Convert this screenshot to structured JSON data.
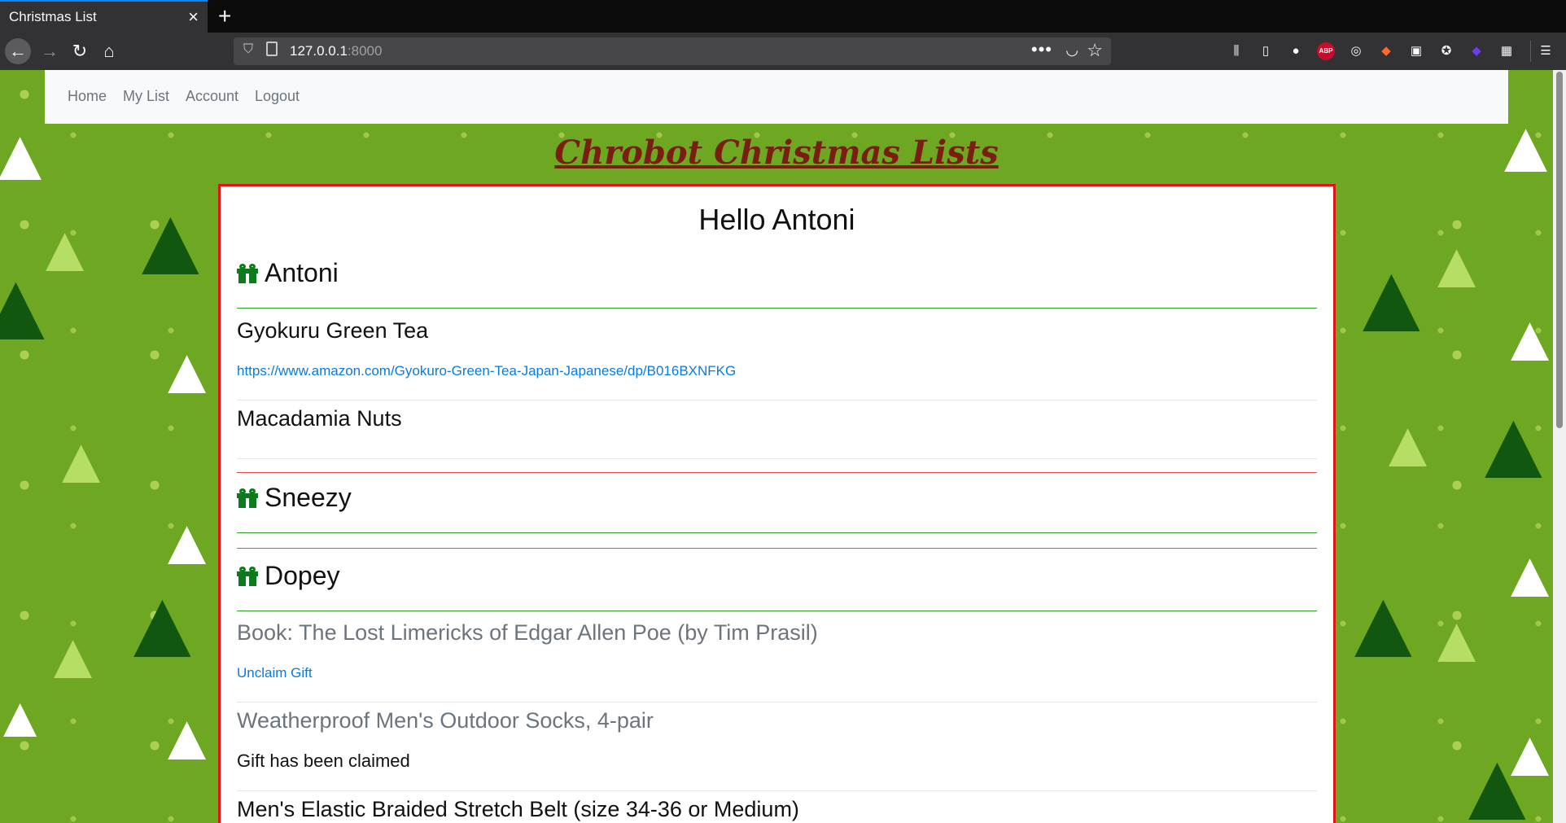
{
  "browser": {
    "tab_title": "Christmas List",
    "url_host": "127.0.0.1",
    "url_port": ":8000"
  },
  "nav": {
    "home": "Home",
    "my_list": "My List",
    "account": "Account",
    "logout": "Logout"
  },
  "site_title": "Chrobot Christmas Lists",
  "greeting": "Hello Antoni",
  "people": [
    {
      "name": "Antoni",
      "items": [
        {
          "title": "Gyokuru Green Tea",
          "link": "https://www.amazon.com/Gyokuro-Green-Tea-Japan-Japanese/dp/B016BXNFKG"
        },
        {
          "title": "Macadamia Nuts"
        }
      ]
    },
    {
      "name": "Sneezy",
      "items": []
    },
    {
      "name": "Dopey",
      "items": [
        {
          "title": "Book: The Lost Limericks of Edgar Allen Poe (by Tim Prasil)",
          "action": "Unclaim Gift"
        },
        {
          "title": "Weatherproof Men's Outdoor Socks, 4-pair",
          "status": "Gift has been claimed"
        },
        {
          "title": "Men's Elastic Braided Stretch Belt (size 34-36 or Medium)"
        }
      ]
    }
  ]
}
